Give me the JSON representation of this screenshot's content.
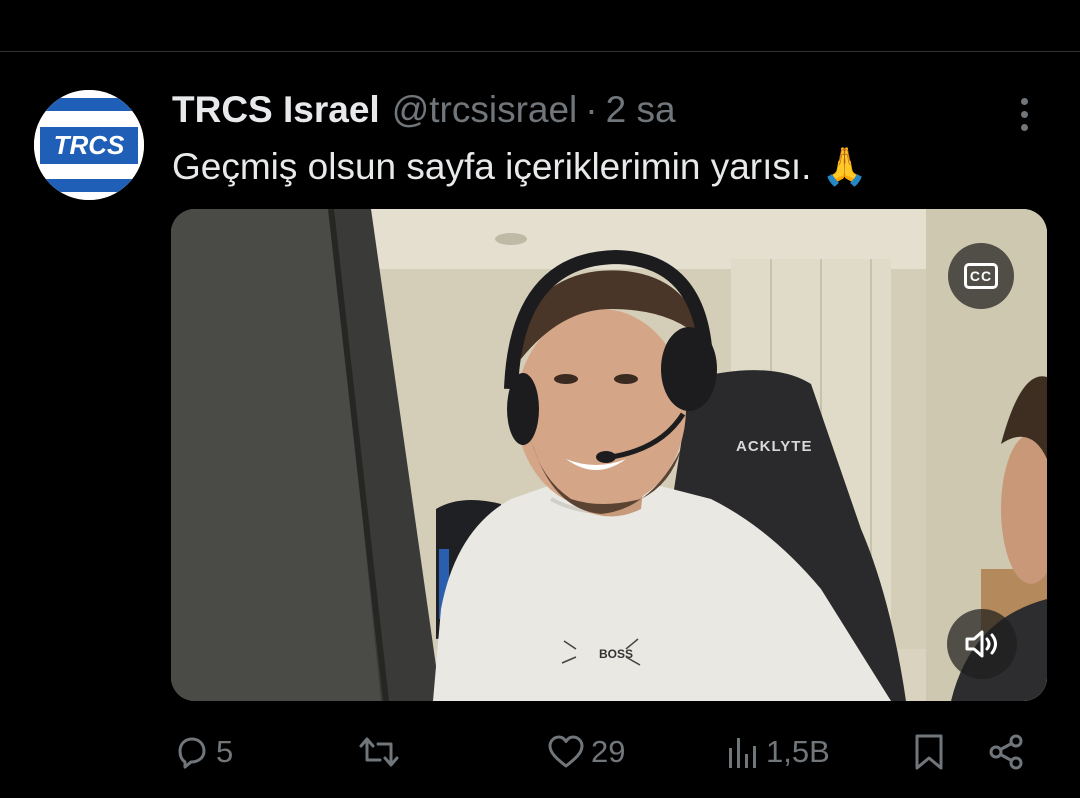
{
  "tweet": {
    "author": {
      "display_name": "TRCS Israel",
      "handle": "@trcsisrael",
      "avatar_text": "TRCS"
    },
    "separator": "·",
    "time": "2 sa",
    "text": "Geçmiş olsun sayfa içeriklerimin yarısı. 🙏",
    "media": {
      "type": "video",
      "captions_label": "CC",
      "chair_brand": "ACKLYTE",
      "shirt_print": "BOSS"
    },
    "actions": {
      "reply_count": "5",
      "retweet_count": "",
      "like_count": "29",
      "views_count": "1,5B"
    }
  },
  "colors": {
    "background": "#000000",
    "text_primary": "#e7e9ea",
    "text_secondary": "#71767b",
    "divider": "#2f3336",
    "avatar_blue": "#1f5fb8"
  }
}
